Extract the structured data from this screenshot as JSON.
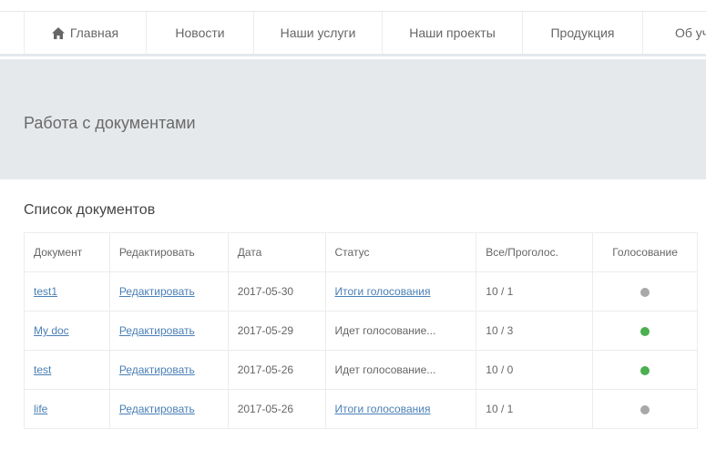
{
  "nav": {
    "items": [
      {
        "label": "Главная",
        "icon": "home-icon"
      },
      {
        "label": "Новости"
      },
      {
        "label": "Наши услуги"
      },
      {
        "label": "Наши проекты"
      },
      {
        "label": "Продукция"
      },
      {
        "label": "Об учр"
      }
    ]
  },
  "banner": {
    "title": "Работа с документами"
  },
  "section": {
    "title": "Список документов"
  },
  "table": {
    "headers": [
      "Документ",
      "Редактировать",
      "Дата",
      "Статус",
      "Все/Проголос.",
      "Голосование"
    ],
    "rows": [
      {
        "doc": "test1",
        "edit": "Редактировать",
        "date": "2017-05-30",
        "status": "Итоги голосования",
        "status_link": true,
        "votes": "10 / 1",
        "voting": "closed"
      },
      {
        "doc": "My doc",
        "edit": "Редактировать",
        "date": "2017-05-29",
        "status": "Идет голосование...",
        "status_link": false,
        "votes": "10 / 3",
        "voting": "open"
      },
      {
        "doc": "test",
        "edit": "Редактировать",
        "date": "2017-05-26",
        "status": "Идет голосование...",
        "status_link": false,
        "votes": "10 / 0",
        "voting": "open"
      },
      {
        "doc": "life",
        "edit": "Редактировать",
        "date": "2017-05-26",
        "status": "Итоги голосования",
        "status_link": true,
        "votes": "10 / 1",
        "voting": "closed"
      }
    ]
  },
  "colors": {
    "link": "#4a7fb5",
    "dot_open": "#4caf50",
    "dot_closed": "#a8a8a8",
    "banner_bg": "#e6e9ec"
  }
}
